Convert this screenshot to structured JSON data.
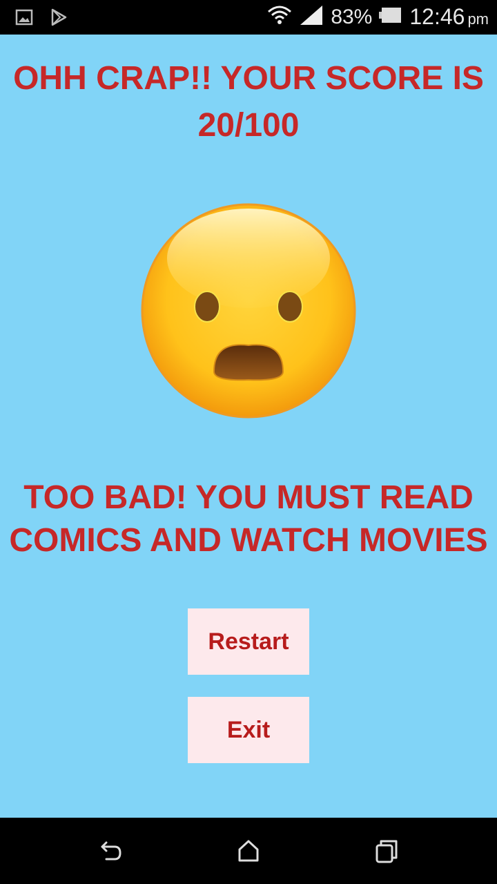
{
  "status_bar": {
    "battery_percent": "83%",
    "time": "12:46",
    "ampm": "pm",
    "icons": [
      "gallery-icon",
      "play-store-icon",
      "wifi-icon",
      "signal-icon",
      "battery-icon"
    ]
  },
  "result": {
    "headline": "OHH CRAP!! YOUR SCORE IS 20/100",
    "emoji": "frowning-face-open-mouth",
    "message": "TOO BAD! YOU MUST READ COMICS AND WATCH MOVIES"
  },
  "buttons": {
    "restart_label": "Restart",
    "exit_label": "Exit"
  },
  "nav_bar": {
    "icons": [
      "back-icon",
      "home-icon",
      "recents-icon"
    ]
  },
  "colors": {
    "background": "#81d4f7",
    "text_red": "#c62828",
    "button_bg": "#fde9ec"
  }
}
